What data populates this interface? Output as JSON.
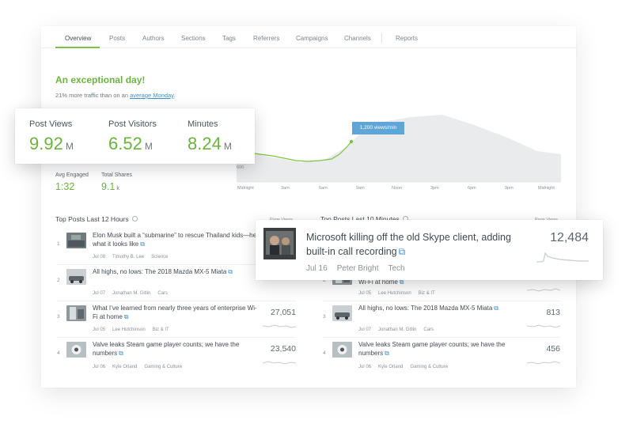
{
  "nav": {
    "tabs": [
      "Overview",
      "Posts",
      "Authors",
      "Sections",
      "Tags",
      "Referrers",
      "Campaigns",
      "Channels",
      "Reports"
    ],
    "active": "Overview"
  },
  "summary": {
    "headline": "An exceptional day!",
    "subline_prefix": "21% more traffic than on an ",
    "subline_link": "average Monday",
    "subline_suffix": "."
  },
  "metrics": [
    {
      "label": "Post Views",
      "value": "9.92",
      "unit": "M"
    },
    {
      "label": "Post Visitors",
      "value": "6.52",
      "unit": "M"
    },
    {
      "label": "Minutes",
      "value": "8.24",
      "unit": "M"
    }
  ],
  "secondary_metrics": [
    {
      "label": "Avg Engaged",
      "value": "1:32",
      "unit": ""
    },
    {
      "label": "Total Shares",
      "value": "9.1",
      "unit": "k"
    }
  ],
  "chart": {
    "tooltip": "1,200 views/min",
    "y_tick": "600",
    "x_ticks": [
      "Midnight",
      "3am",
      "6am",
      "9am",
      "Noon",
      "3pm",
      "6pm",
      "9pm",
      "Midnight"
    ],
    "colors": {
      "line": "#7dc242",
      "area": "#e8eaeb"
    }
  },
  "left_section": {
    "title": "Top Posts Last 12 Hours",
    "column": "Page Views",
    "posts": [
      {
        "rank": "1",
        "title": "Elon Musk built a “submarine” to rescue Thailand kids—here’s what it looks like",
        "date": "Jul 08",
        "author": "Timothy B. Lee",
        "section": "Science",
        "views": ""
      },
      {
        "rank": "2",
        "title": "All highs, no lows: The 2018 Mazda MX-5 Miata",
        "date": "Jul 07",
        "author": "Jonathan M. Gitlin",
        "section": "Cars",
        "views": ""
      },
      {
        "rank": "3",
        "title": "What I’ve learned from nearly three years of enterprise Wi-Fi at home",
        "date": "Jul 05",
        "author": "Lee Hutchinson",
        "section": "Biz & IT",
        "views": "27,051"
      },
      {
        "rank": "4",
        "title": "Valve leaks Steam game player counts; we have the numbers",
        "date": "Jul 06",
        "author": "Kyle Orland",
        "section": "Gaming & Culture",
        "views": "23,540"
      }
    ]
  },
  "right_section": {
    "title": "Top Posts Last 10 Minutes",
    "column": "Page Views",
    "posts": [
      {
        "rank": "2",
        "title": "Wi-Fi at home",
        "date": "Jul 05",
        "author": "Lee Hutchinson",
        "section": "Biz & IT",
        "views": ""
      },
      {
        "rank": "3",
        "title": "All highs, no lows: The 2018 Mazda MX-5 Miata",
        "date": "Jul 07",
        "author": "Jonathan M. Gitlin",
        "section": "Cars",
        "views": "813"
      },
      {
        "rank": "4",
        "title": "Valve leaks Steam game player counts; we have the numbers",
        "date": "Jul 06",
        "author": "Kyle Orland",
        "section": "Gaming & Culture",
        "views": "456"
      }
    ]
  },
  "highlight_post": {
    "title": "Microsoft killing off the old Skype client, adding built-in call recording",
    "date": "Jul 16",
    "author": "Peter Bright",
    "section": "Tech",
    "views": "12,484"
  },
  "icons": {
    "external": "external-link-icon",
    "info": "info-icon"
  }
}
